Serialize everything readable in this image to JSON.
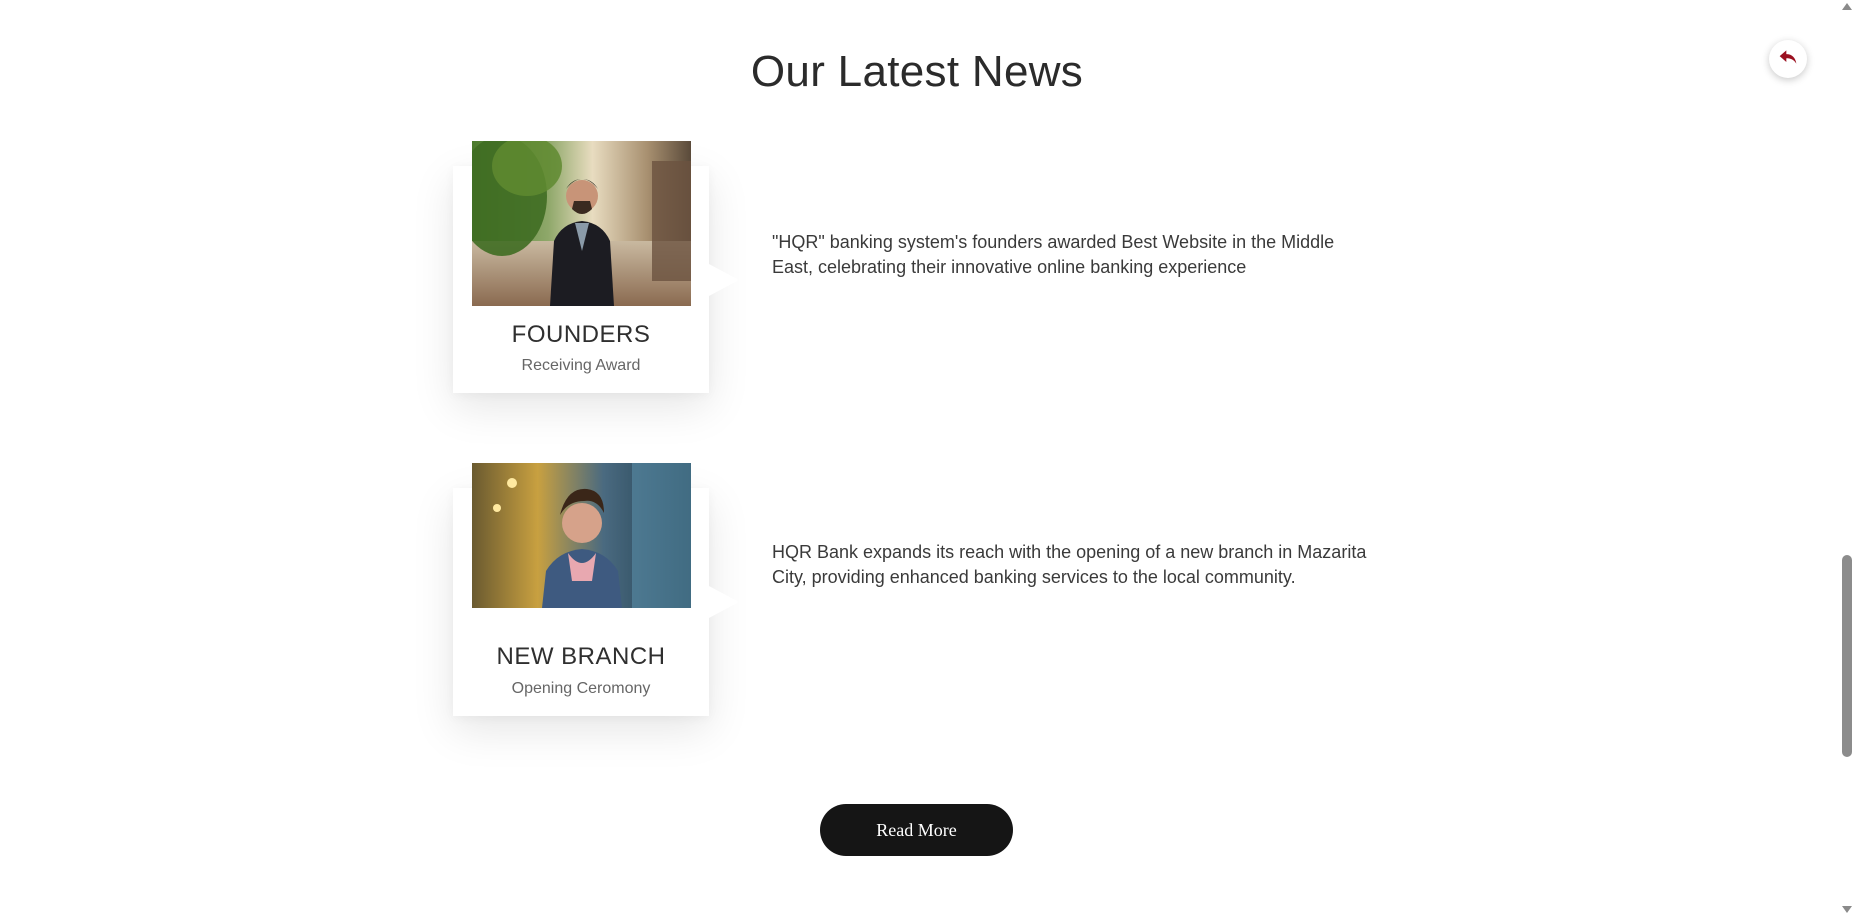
{
  "section": {
    "title": "Our Latest News"
  },
  "back_button": {
    "icon": "reply-arrow-icon",
    "color": "#9b1020"
  },
  "news": [
    {
      "title": "FOUNDERS",
      "subtitle": "Receiving Award",
      "text": "\"HQR\" banking system's founders awarded Best Website in the Middle East, celebrating their innovative online banking experience"
    },
    {
      "title": "NEW BRANCH",
      "subtitle": "Opening Ceromony",
      "text": "HQR Bank expands its reach with the opening of a new branch in Mazarita City, providing enhanced banking services to the local community."
    }
  ],
  "read_more": {
    "label": "Read More"
  }
}
